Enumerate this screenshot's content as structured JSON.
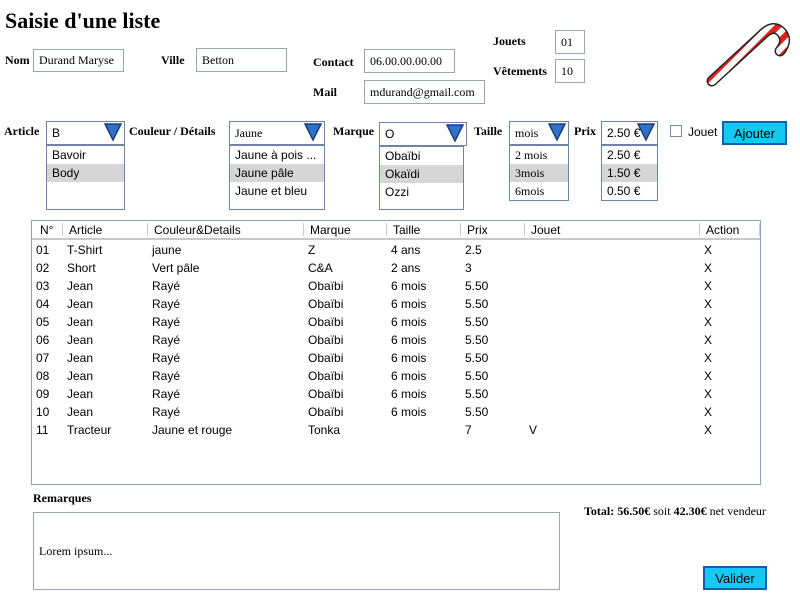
{
  "title": "Saisie d'une liste",
  "nom": {
    "label": "Nom",
    "value": "Durand Maryse"
  },
  "ville": {
    "label": "Ville",
    "value": "Betton"
  },
  "contact": {
    "label": "Contact",
    "value": "06.00.00.00.00"
  },
  "mail": {
    "label": "Mail",
    "value": "mdurand@gmail.com"
  },
  "jouets": {
    "label": "Jouets",
    "value": "01"
  },
  "vetements": {
    "label": "Vêtements",
    "value": "10"
  },
  "article": {
    "label": "Article",
    "value": "B",
    "options": [
      "Bavoir",
      "Body"
    ],
    "selected": 1
  },
  "couleur": {
    "label": "Couleur / Détails",
    "value": "Jaune",
    "options": [
      "Jaune à pois ...",
      "Jaune pâle",
      "Jaune et bleu"
    ],
    "selected": 1
  },
  "marque": {
    "label": "Marque",
    "value": "O",
    "options": [
      "Obaïbi",
      "Okaïdi",
      "Ozzi"
    ],
    "selected": 1
  },
  "taille": {
    "label": "Taille",
    "value": "mois",
    "options": [
      "2 mois",
      "3mois",
      "6mois"
    ],
    "selected": 1
  },
  "prix": {
    "label": "Prix",
    "value": "2.50 €",
    "options": [
      "2.50 €",
      "1.50 €",
      "0.50 €"
    ],
    "selected": 1
  },
  "jouet_checkbox": {
    "label": "Jouet",
    "checked": false
  },
  "ajouter_label": "Ajouter",
  "table": {
    "headers": [
      "N°",
      "Article",
      "Couleur&Details",
      "Marque",
      "Taille",
      "Prix",
      "Jouet",
      "Action"
    ],
    "rows": [
      [
        "01",
        "T-Shirt",
        "jaune",
        "Z",
        "4 ans",
        "2.5",
        "",
        "X"
      ],
      [
        "02",
        "Short",
        "Vert pâle",
        "C&A",
        "2 ans",
        "3",
        "",
        "X"
      ],
      [
        "03",
        "Jean",
        "Rayé",
        "Obaïbi",
        "6 mois",
        "5.50",
        "",
        "X"
      ],
      [
        "04",
        "Jean",
        "Rayé",
        "Obaïbi",
        "6 mois",
        "5.50",
        "",
        "X"
      ],
      [
        "05",
        "Jean",
        "Rayé",
        "Obaïbi",
        "6 mois",
        "5.50",
        "",
        "X"
      ],
      [
        "06",
        "Jean",
        "Rayé",
        "Obaïbi",
        "6 mois",
        "5.50",
        "",
        "X"
      ],
      [
        "07",
        "Jean",
        "Rayé",
        "Obaïbi",
        "6 mois",
        "5.50",
        "",
        "X"
      ],
      [
        "08",
        "Jean",
        "Rayé",
        "Obaïbi",
        "6 mois",
        "5.50",
        "",
        "X"
      ],
      [
        "09",
        "Jean",
        "Rayé",
        "Obaïbi",
        "6 mois",
        "5.50",
        "",
        "X"
      ],
      [
        "10",
        "Jean",
        "Rayé",
        "Obaïbi",
        "6 mois",
        "5.50",
        "",
        "X"
      ],
      [
        "11",
        "Tracteur",
        "Jaune et rouge",
        "Tonka",
        "",
        "7",
        "V",
        "X"
      ]
    ]
  },
  "remarques": {
    "label": "Remarques",
    "value": "Lorem ipsum..."
  },
  "total": {
    "prefix": "Total:",
    "amount": "56.50€",
    "middle": "soit",
    "net": "42.30€",
    "suffix": "net vendeur"
  },
  "valider_label": "Valider",
  "icons": {
    "logo": "candy-cane-icon",
    "dropdown": "triangle-down-icon"
  },
  "colors": {
    "button": "#14c8f2",
    "button_border": "#1a5ca8",
    "arrow": "#2e73c9",
    "cane_red": "#e0241b"
  }
}
